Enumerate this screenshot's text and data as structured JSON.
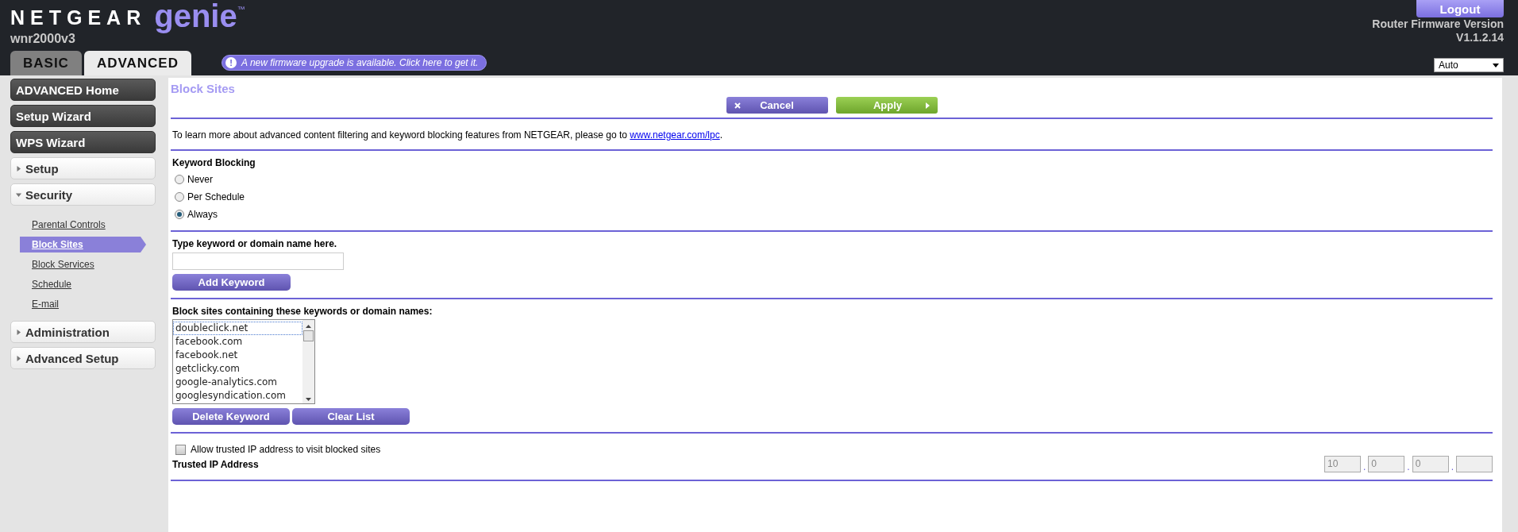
{
  "header": {
    "brand": "NETGEAR",
    "product": "genie",
    "trademark": "™",
    "model": "wnr2000v3",
    "logout": "Logout",
    "firmware_label": "Router Firmware Version",
    "firmware_version": "V1.1.2.14",
    "language": "Auto"
  },
  "tabs": [
    {
      "label": "BASIC",
      "selected": false
    },
    {
      "label": "ADVANCED",
      "selected": true
    }
  ],
  "notice": {
    "icon_text": "!",
    "text": "A new firmware upgrade is available. Click here to get it."
  },
  "sidebar": {
    "items": [
      {
        "kind": "button",
        "label": "ADVANCED Home"
      },
      {
        "kind": "button",
        "label": "Setup Wizard"
      },
      {
        "kind": "button",
        "label": "WPS Wizard"
      },
      {
        "kind": "section",
        "label": "Setup",
        "expanded": false
      },
      {
        "kind": "section",
        "label": "Security",
        "expanded": true,
        "children": [
          {
            "label": "Parental Controls",
            "selected": false
          },
          {
            "label": "Block Sites",
            "selected": true
          },
          {
            "label": "Block Services",
            "selected": false
          },
          {
            "label": "Schedule",
            "selected": false
          },
          {
            "label": "E-mail",
            "selected": false
          }
        ]
      },
      {
        "kind": "section",
        "label": "Administration",
        "expanded": false
      },
      {
        "kind": "section",
        "label": "Advanced Setup",
        "expanded": false
      }
    ]
  },
  "page": {
    "title": "Block Sites",
    "cancel": "Cancel",
    "apply": "Apply",
    "intro": "To learn more about advanced content filtering and keyword blocking features from NETGEAR, please go to ",
    "intro_link": "www.netgear.com/lpc",
    "intro_end": ".",
    "keyword_blocking": {
      "label": "Keyword Blocking",
      "options": [
        {
          "label": "Never",
          "selected": false
        },
        {
          "label": "Per Schedule",
          "selected": false
        },
        {
          "label": "Always",
          "selected": true
        }
      ]
    },
    "keyword_input": {
      "label": "Type keyword or domain name here.",
      "button": "Add Keyword"
    },
    "blocked_list": {
      "label": "Block sites containing these keywords or domain names:",
      "items": [
        {
          "label": "doubleclick.net",
          "focused": true
        },
        {
          "label": "facebook.com",
          "focused": false
        },
        {
          "label": "facebook.net",
          "focused": false
        },
        {
          "label": "getclicky.com",
          "focused": false
        },
        {
          "label": "google-analytics.com",
          "focused": false
        },
        {
          "label": "googlesyndication.com",
          "focused": false
        }
      ],
      "delete": "Delete Keyword",
      "clear": "Clear List"
    },
    "trusted": {
      "checkbox_label": "Allow trusted IP address to visit blocked sites",
      "checked": false,
      "ip_label": "Trusted IP Address",
      "disabled": true,
      "separator": ".",
      "octets": [
        {
          "kind": "filled",
          "value": "10"
        },
        {
          "kind": "filled",
          "value": "0"
        },
        {
          "kind": "filled",
          "value": "0"
        },
        {
          "kind": "blank"
        }
      ]
    }
  }
}
